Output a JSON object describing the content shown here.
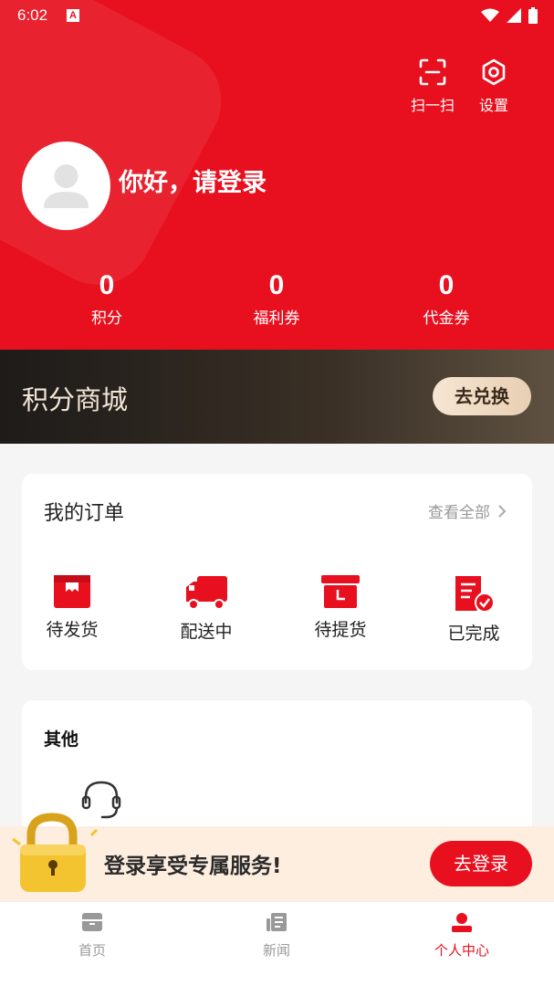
{
  "status_bar": {
    "time": "6:02",
    "notification_letter": "A"
  },
  "header": {
    "scan_label": "扫一扫",
    "settings_label": "设置",
    "greeting": "你好，请登录"
  },
  "stats": [
    {
      "value": "0",
      "label": "积分"
    },
    {
      "value": "0",
      "label": "福利券"
    },
    {
      "value": "0",
      "label": "代金券"
    }
  ],
  "mall": {
    "title": "积分商城",
    "button": "去兑换"
  },
  "orders": {
    "title": "我的订单",
    "view_all": "查看全部",
    "items": [
      {
        "label": "待发货",
        "icon": "pending-shipment-icon"
      },
      {
        "label": "配送中",
        "icon": "delivery-truck-icon"
      },
      {
        "label": "待提货",
        "icon": "pickup-box-icon"
      },
      {
        "label": "已完成",
        "icon": "completed-order-icon"
      }
    ]
  },
  "others": {
    "title": "其他",
    "service_icon": "customer-service-icon"
  },
  "login_prompt": {
    "text": "登录享受专属服务!",
    "button": "去登录"
  },
  "tabbar": [
    {
      "label": "首页",
      "icon": "home-icon"
    },
    {
      "label": "新闻",
      "icon": "news-icon"
    },
    {
      "label": "个人中心",
      "icon": "profile-icon"
    }
  ],
  "colors": {
    "brand_red": "#e8101f",
    "mall_gold": "#f1e6d6",
    "prompt_bg": "#fdeee0"
  }
}
